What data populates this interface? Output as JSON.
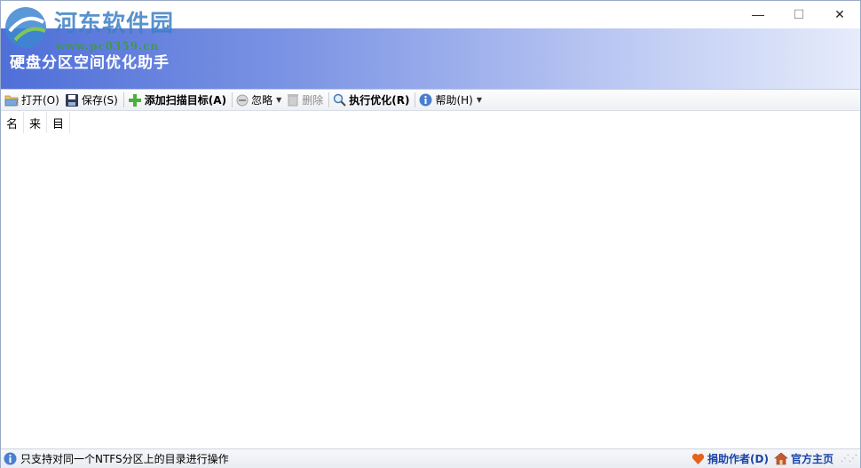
{
  "window": {
    "watermark_text": "河东软件园",
    "watermark_url": "www.pc0359.cn",
    "banner_title": "硬盘分区空间优化助手",
    "controls": {
      "minimize": "—",
      "maximize": "☐",
      "close": "✕"
    }
  },
  "toolbar": {
    "open_label": "打开(O)",
    "save_label": "保存(S)",
    "add_target_label": "添加扫描目标(A)",
    "ignore_label": "忽略",
    "delete_label": "删除",
    "optimize_label": "执行优化(R)",
    "help_label": "帮助(H)"
  },
  "list": {
    "columns": [
      "名",
      "来",
      "目"
    ]
  },
  "statusbar": {
    "message": "只支持对同一个NTFS分区上的目录进行操作",
    "donate_label": "捐助作者(D)",
    "homepage_label": "官方主页"
  },
  "colors": {
    "banner_start": "#4f6fd8",
    "banner_end": "#e6ecfb",
    "link": "#1a44a8"
  }
}
